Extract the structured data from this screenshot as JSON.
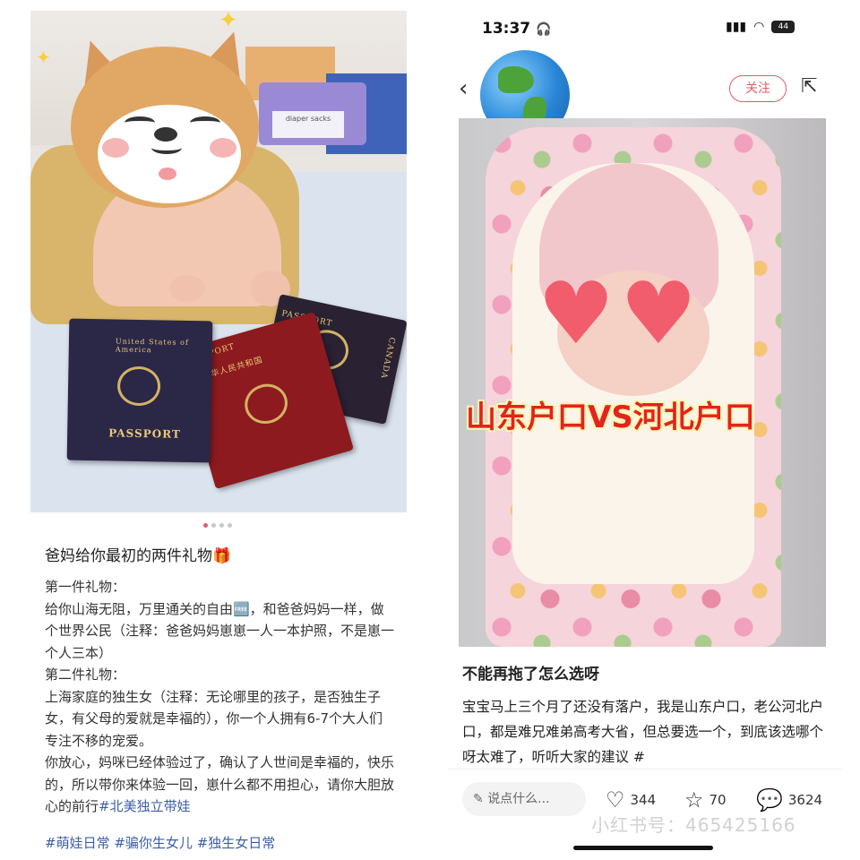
{
  "left_post": {
    "image": {
      "sticker": "shiba-dog-emoji",
      "passports": {
        "us": {
          "label": "PASSPORT",
          "issuer": "United States of America"
        },
        "cn": {
          "label": "PASSPORT",
          "issuer": "中华人民共和国"
        },
        "ca": {
          "label": "CANADA",
          "sub": "PASSPORT"
        }
      },
      "box_text": "diaper sacks"
    },
    "carousel": {
      "count": 4,
      "active_index": 0
    },
    "title": "爸妈给你最初的两件礼物",
    "title_emoji": "🎁",
    "paragraphs": [
      "第一件礼物：",
      "给你山海无阻，万里通关的自由🆓，和爸爸妈妈一样，做个世界公民（注释：爸爸妈妈崽崽一人一本护照，不是崽一个人三本）",
      "第二件礼物：",
      "上海家庭的独生女（注释：无论哪里的孩子，是否独生子女，有父母的爱就是幸福的），你一个人拥有6-7个大人们专注不移的宠爱。",
      "你放心，妈咪已经体验过了，确认了人世间是幸福的，快乐的，所以带你来体验一回，崽什么都不用担心，请你大胆放心的前行"
    ],
    "tags_inline": "#北美独立带娃",
    "tags": [
      "#萌娃日常",
      "#骗你生女儿",
      "#独生女日常"
    ]
  },
  "right_post": {
    "status_bar": {
      "time": "13:37",
      "headphone_icon": "headphones-icon",
      "battery": "44"
    },
    "nav": {
      "back_icon": "chevron-left-icon",
      "follow_label": "关注",
      "share_icon": "share-icon"
    },
    "avatar_icon": "globe-emoji",
    "image_overlay_text": "山东户口VS河北户口",
    "title": "不能再拖了怎么选呀",
    "body": "宝宝马上三个月了还没有落户，我是山东户口，老公河北户口，都是难兄难弟高考大省，但总要选一个，到底该选哪个呀太难了，听听大家的建议 #",
    "comment_placeholder": "说点什么...",
    "likes": "344",
    "collects": "70",
    "comments": "3624",
    "watermark": "小红书号：465425166"
  },
  "colors": {
    "accent_red": "#e35b63",
    "link_blue": "#3b5ea8",
    "overlay_text_red": "#e32221"
  }
}
